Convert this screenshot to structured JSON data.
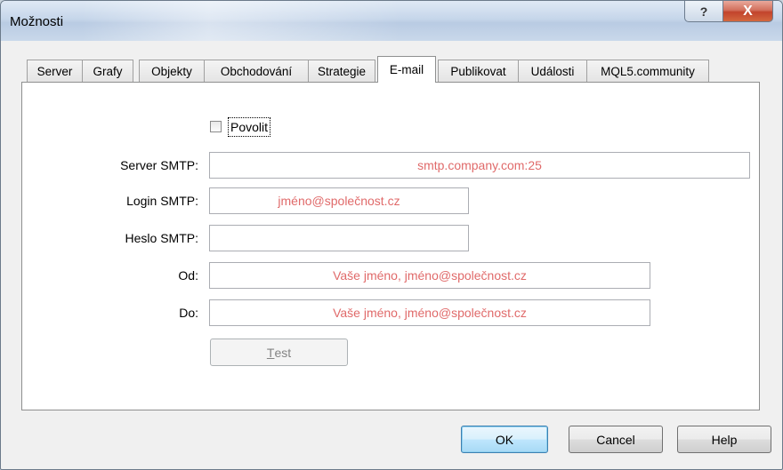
{
  "window": {
    "title": "Možnosti",
    "help_glyph": "?",
    "close_glyph": "X"
  },
  "tabs": [
    {
      "label": "Server"
    },
    {
      "label": "Grafy"
    },
    {
      "label": "Objekty"
    },
    {
      "label": "Obchodování"
    },
    {
      "label": "Strategie"
    },
    {
      "label": "E-mail",
      "active": true
    },
    {
      "label": "Publikovat"
    },
    {
      "label": "Události"
    },
    {
      "label": "MQL5.community"
    }
  ],
  "email": {
    "enable_label": "Povolit",
    "enable_checked": false,
    "smtp_server_label": "Server SMTP:",
    "smtp_server_placeholder": "smtp.company.com:25",
    "smtp_login_label": "Login SMTP:",
    "smtp_login_placeholder": "jméno@společnost.cz",
    "smtp_password_label": "Heslo SMTP:",
    "smtp_password_value": "",
    "from_label": "Od:",
    "from_placeholder": "Vaše jméno, jméno@společnost.cz",
    "to_label": "Do:",
    "to_placeholder": "Vaše jméno, jméno@společnost.cz",
    "test_button_rest": "est",
    "test_button_accel": "T"
  },
  "footer": {
    "ok_label": "OK",
    "cancel_label": "Cancel",
    "help_label": "Help"
  }
}
